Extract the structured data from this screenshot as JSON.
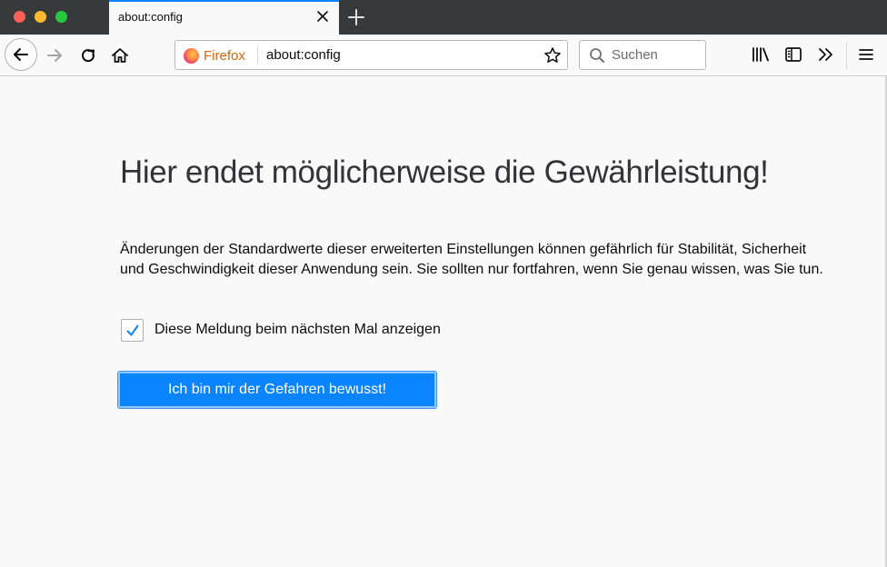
{
  "window": {
    "traffic_lights": {
      "close": "#fe5f57",
      "minimize": "#febc2e",
      "zoom": "#28c840"
    }
  },
  "tabs": [
    {
      "title": "about:config",
      "active": true
    }
  ],
  "toolbar": {
    "identity_label": "Firefox",
    "url": "about:config",
    "search_placeholder": "Suchen",
    "icons": [
      "back-icon",
      "forward-icon",
      "reload-icon",
      "home-icon",
      "bookmark-star-icon",
      "search-icon",
      "library-icon",
      "sidebar-icon",
      "overflow-chevron-icon",
      "hamburger-menu-icon"
    ]
  },
  "warning": {
    "title": "Hier endet möglicherweise die Gewährleistung!",
    "text": "Änderungen der Standardwerte dieser erweiterten Einstellungen können gefährlich für Stabilität, Sicherheit und Geschwindigkeit dieser Anwendung sein. Sie sollten nur fortfahren, wenn Sie genau wissen, was Sie tun.",
    "checkbox_label": "Diese Meldung beim nächsten Mal anzeigen",
    "checkbox_checked": true,
    "accept_button": "Ich bin mir der Gefahren bewusst!"
  },
  "colors": {
    "accent": "#0a84ff",
    "tab_strip": "#38393b",
    "page_bg": "#f9f9fa",
    "firefox_label": "#d7660a"
  }
}
